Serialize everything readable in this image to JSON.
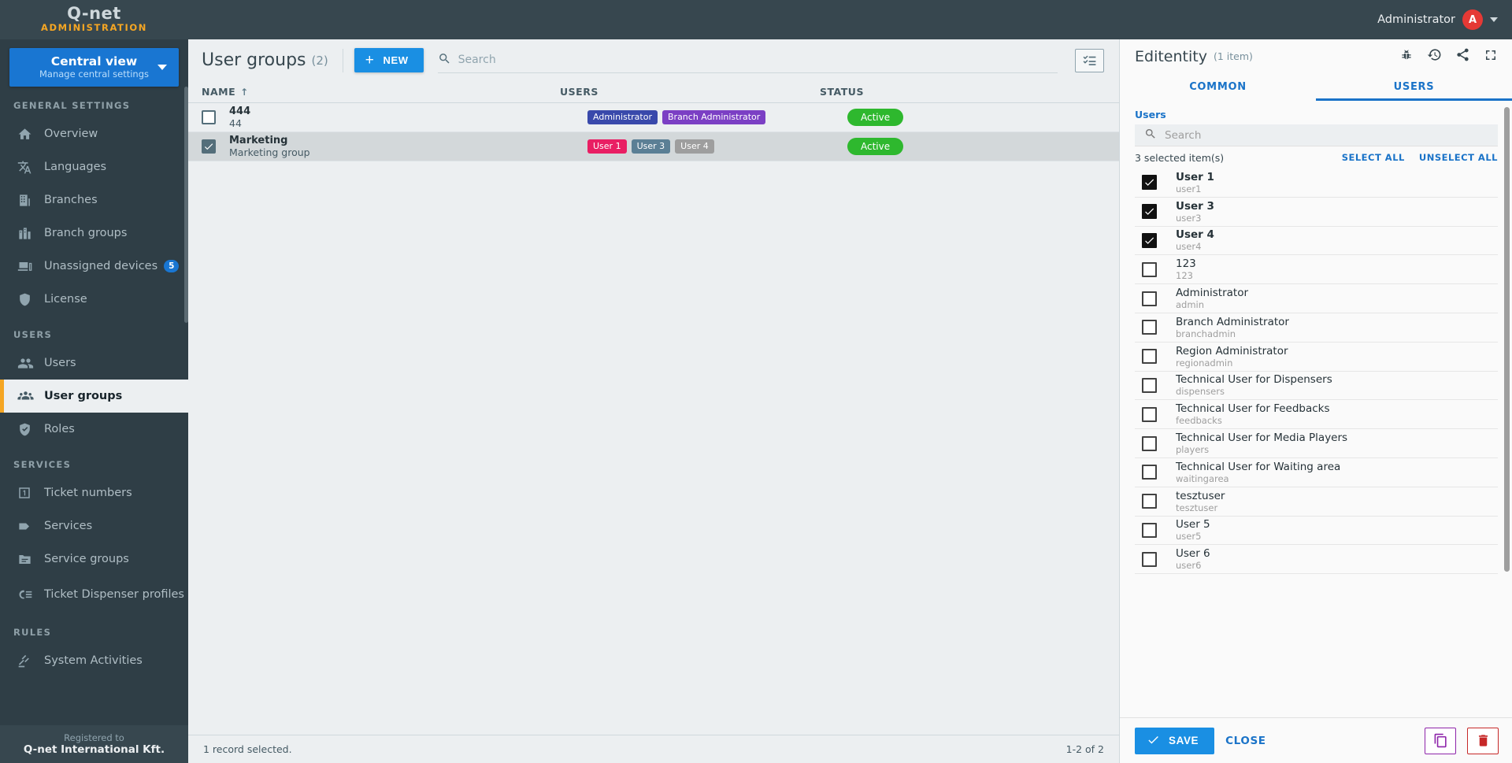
{
  "topbar": {
    "logo_main": "Q-net",
    "logo_sub": "ADMINISTRATION",
    "admin_label": "Administrator",
    "avatar_initial": "A"
  },
  "sidebar": {
    "view_switch": {
      "title": "Central view",
      "subtitle": "Manage central settings"
    },
    "sections": [
      {
        "label": "GENERAL SETTINGS",
        "items": [
          {
            "label": "Overview",
            "icon": "home-icon",
            "active": false,
            "badge": ""
          },
          {
            "label": "Languages",
            "icon": "translate-icon",
            "active": false,
            "badge": ""
          },
          {
            "label": "Branches",
            "icon": "building-icon",
            "active": false,
            "badge": ""
          },
          {
            "label": "Branch groups",
            "icon": "buildings-icon",
            "active": false,
            "badge": ""
          },
          {
            "label": "Unassigned devices",
            "icon": "devices-icon",
            "active": false,
            "badge": "5"
          },
          {
            "label": "License",
            "icon": "shield-icon",
            "active": false,
            "badge": ""
          }
        ]
      },
      {
        "label": "USERS",
        "items": [
          {
            "label": "Users",
            "icon": "users-icon",
            "active": false,
            "badge": ""
          },
          {
            "label": "User groups",
            "icon": "user-groups-icon",
            "active": true,
            "badge": ""
          },
          {
            "label": "Roles",
            "icon": "shield-check-icon",
            "active": false,
            "badge": ""
          }
        ]
      },
      {
        "label": "SERVICES",
        "items": [
          {
            "label": "Ticket numbers",
            "icon": "ticket-number-icon",
            "active": false,
            "badge": ""
          },
          {
            "label": "Services",
            "icon": "tag-icon",
            "active": false,
            "badge": ""
          },
          {
            "label": "Service groups",
            "icon": "folder-icon",
            "active": false,
            "badge": ""
          },
          {
            "label": "Ticket Dispenser profiles",
            "icon": "dispenser-icon",
            "active": false,
            "badge": ""
          }
        ]
      },
      {
        "label": "RULES",
        "items": [
          {
            "label": "System Activities",
            "icon": "gavel-icon",
            "active": false,
            "badge": ""
          }
        ]
      }
    ],
    "footer": {
      "registered_to": "Registered to",
      "company": "Q-net International Kft."
    }
  },
  "main": {
    "title": "User groups",
    "count": "(2)",
    "new_button": "NEW",
    "search_placeholder": "Search",
    "search_value": "",
    "columns": {
      "name": "NAME",
      "users": "USERS",
      "status": "STATUS",
      "sort_indicator": "↑"
    },
    "rows": [
      {
        "checked": false,
        "name": "444",
        "description": "44",
        "chips": [
          {
            "label": "Administrator",
            "color": "#3949ab"
          },
          {
            "label": "Branch Administrator",
            "color": "#7b3fc4"
          }
        ],
        "status": "Active",
        "status_color": "#2eb82e"
      },
      {
        "checked": true,
        "name": "Marketing",
        "description": "Marketing group",
        "chips": [
          {
            "label": "User 1",
            "color": "#e91e63"
          },
          {
            "label": "User 3",
            "color": "#5b7f95"
          },
          {
            "label": "User 4",
            "color": "#9e9e9e"
          }
        ],
        "status": "Active",
        "status_color": "#2eb82e"
      }
    ],
    "footer_left": "1 record selected.",
    "footer_right": "1-2 of 2"
  },
  "panel": {
    "title": "Editentity",
    "count": "(1 item)",
    "icons": [
      "bug-icon",
      "history-icon",
      "share-icon",
      "fullscreen-icon"
    ],
    "tabs": [
      {
        "label": "COMMON",
        "active": false
      },
      {
        "label": "USERS",
        "active": true
      }
    ],
    "users_label": "Users",
    "search_placeholder": "Search",
    "search_value": "",
    "selected_text": "3 selected item(s)",
    "select_all": "SELECT ALL",
    "unselect_all": "UNSELECT ALL",
    "users": [
      {
        "name": "User 1",
        "login": "user1",
        "checked": true
      },
      {
        "name": "User 3",
        "login": "user3",
        "checked": true
      },
      {
        "name": "User 4",
        "login": "user4",
        "checked": true
      },
      {
        "name": "123",
        "login": "123",
        "checked": false
      },
      {
        "name": "Administrator",
        "login": "admin",
        "checked": false
      },
      {
        "name": "Branch Administrator",
        "login": "branchadmin",
        "checked": false
      },
      {
        "name": "Region Administrator",
        "login": "regionadmin",
        "checked": false
      },
      {
        "name": "Technical User for Dispensers",
        "login": "dispensers",
        "checked": false
      },
      {
        "name": "Technical User for Feedbacks",
        "login": "feedbacks",
        "checked": false
      },
      {
        "name": "Technical User for Media Players",
        "login": "players",
        "checked": false
      },
      {
        "name": "Technical User for Waiting area",
        "login": "waitingarea",
        "checked": false
      },
      {
        "name": "tesztuser",
        "login": "tesztuser",
        "checked": false
      },
      {
        "name": "User 5",
        "login": "user5",
        "checked": false
      },
      {
        "name": "User 6",
        "login": "user6",
        "checked": false
      }
    ],
    "save_label": "SAVE",
    "close_label": "CLOSE"
  },
  "colors": {
    "accent_blue": "#1a8fe3",
    "link_blue": "#1a73c8",
    "sidebar_bg": "#2f3e46",
    "topbar_bg": "#37474f",
    "active_marker": "#f5a623",
    "status_green": "#2eb82e",
    "copy_purple": "#8e24aa",
    "delete_red": "#c62828"
  }
}
